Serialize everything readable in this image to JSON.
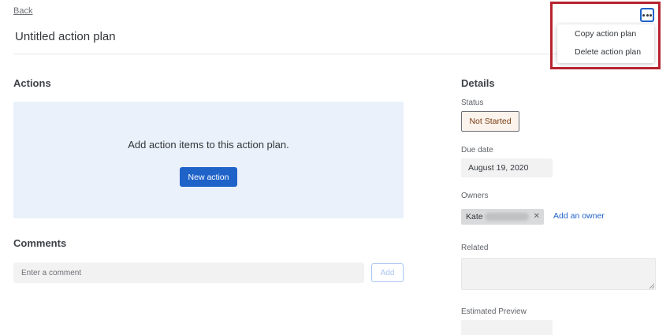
{
  "nav": {
    "back_label": "Back"
  },
  "header": {
    "title": "Untitled action plan"
  },
  "actions": {
    "heading": "Actions",
    "empty_message": "Add action items to this action plan.",
    "new_action_label": "New action"
  },
  "comments": {
    "heading": "Comments",
    "placeholder": "Enter a comment",
    "add_label": "Add"
  },
  "details": {
    "heading": "Details",
    "status_label": "Status",
    "status_value": "Not Started",
    "due_label": "Due date",
    "due_value": "August 19, 2020",
    "owners_label": "Owners",
    "owner_name": "Kate",
    "owner_remove_glyph": "✕",
    "add_owner_label": "Add an owner",
    "related_label": "Related",
    "preview_label": "Estimated Preview"
  },
  "menu": {
    "items": [
      {
        "label": "Copy action plan"
      },
      {
        "label": "Delete action plan"
      }
    ]
  },
  "colors": {
    "accent": "#1f63c9",
    "status_text": "#7a3b10",
    "status_bg": "#fbf3ec",
    "actions_panel_bg": "#ebf1fa",
    "highlight": "#b6232f"
  }
}
